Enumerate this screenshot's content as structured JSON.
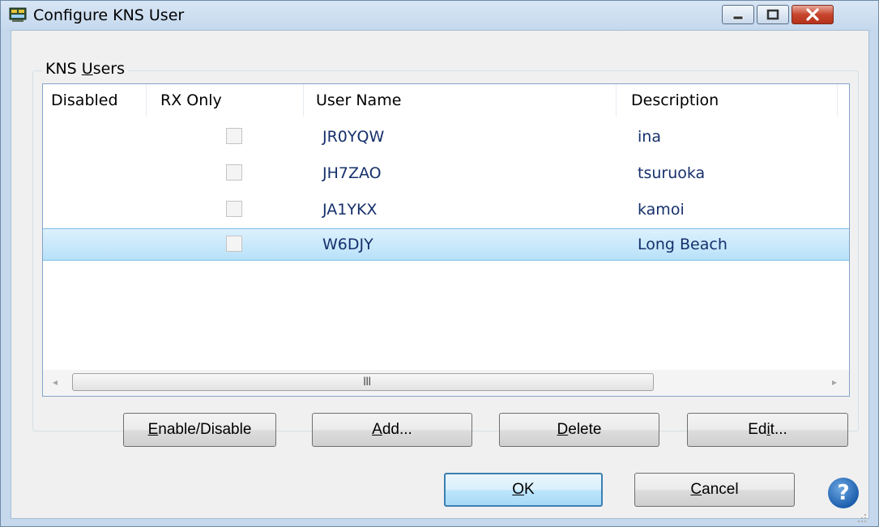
{
  "window": {
    "title": "Configure KNS User",
    "icons": {
      "app": "app-icon",
      "minimize": "minimize-icon",
      "maximize": "maximize-icon",
      "close": "close-icon",
      "help": "help-icon"
    },
    "close_color": "#c7452d"
  },
  "group": {
    "label_prefix": "KNS ",
    "label_mnemonic": "U",
    "label_rest": "sers"
  },
  "table": {
    "columns": [
      "Disabled",
      "RX Only",
      "User Name",
      "Description"
    ],
    "rows": [
      {
        "disabled": "",
        "rx_only": false,
        "user_name": "JR0YQW",
        "description": "ina"
      },
      {
        "disabled": "",
        "rx_only": false,
        "user_name": "JH7ZAO",
        "description": "tsuruoka"
      },
      {
        "disabled": "",
        "rx_only": false,
        "user_name": "JA1YKX",
        "description": "kamoi"
      },
      {
        "disabled": "",
        "rx_only": false,
        "user_name": "W6DJY",
        "description": "Long Beach"
      }
    ],
    "selected_row_index": 3,
    "selection_color": "#b8e1f9",
    "text_color": "#15306b",
    "scrollbar": {
      "grip_glyph": "III",
      "left_arrow": "◂",
      "right_arrow": "▸"
    }
  },
  "buttons": {
    "enable_disable": {
      "mnemonic": "E",
      "rest": "nable/Disable"
    },
    "add": {
      "mnemonic": "A",
      "rest": "dd..."
    },
    "delete": {
      "mnemonic": "D",
      "rest": "elete"
    },
    "edit": {
      "pre": "Ed",
      "mnemonic": "i",
      "rest": "t..."
    },
    "ok": {
      "mnemonic": "O",
      "rest": "K"
    },
    "cancel": {
      "mnemonic": "C",
      "rest": "ancel"
    },
    "help_glyph": "?"
  }
}
